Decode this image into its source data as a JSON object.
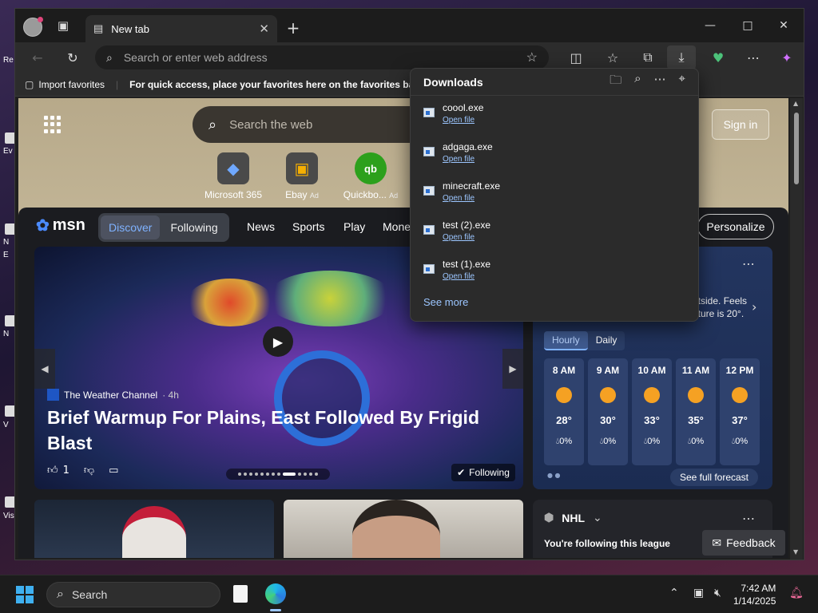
{
  "desktop": {
    "labels": [
      "Re",
      "Ev",
      "N",
      "E",
      "N",
      "V",
      "Vis"
    ]
  },
  "tab": {
    "title": "New tab"
  },
  "address": {
    "placeholder": "Search or enter web address"
  },
  "favorites": {
    "import": "Import favorites",
    "hint": "For quick access, place your favorites here on the favorites bar."
  },
  "newtab": {
    "search_placeholder": "Search the web",
    "signin": "Sign in",
    "quick_links": [
      {
        "label": "Microsoft 365",
        "ad": ""
      },
      {
        "label": "Ebay",
        "ad": "Ad"
      },
      {
        "label": "Quickbo...",
        "ad": "Ad"
      }
    ]
  },
  "msn": {
    "logo": "msn",
    "tabs": {
      "discover": "Discover",
      "following": "Following"
    },
    "nav": [
      "News",
      "Sports",
      "Play",
      "Mone"
    ],
    "personalize": "Personalize",
    "hero": {
      "source": "The Weather Channel",
      "age": "· 4h",
      "headline": "Brief Warmup For Plains, East Followed By Frigid Blast",
      "likes": "1",
      "following": "Following"
    },
    "weather": {
      "summary_line1": "utside. Feels",
      "summary_line2": "ature is 20°.",
      "tab_hourly": "Hourly",
      "tab_daily": "Daily",
      "hours": [
        {
          "time": "8 AM",
          "temp": "28°",
          "precip": "0%"
        },
        {
          "time": "9 AM",
          "temp": "30°",
          "precip": "0%"
        },
        {
          "time": "10 AM",
          "temp": "33°",
          "precip": "0%"
        },
        {
          "time": "11 AM",
          "temp": "35°",
          "precip": "0%"
        },
        {
          "time": "12 PM",
          "temp": "37°",
          "precip": "0%"
        }
      ],
      "forecast": "See full forecast"
    },
    "nhl": {
      "title": "NHL",
      "subtitle": "You're following this league"
    },
    "feedback": "Feedback"
  },
  "downloads": {
    "title": "Downloads",
    "items": [
      {
        "name": "coool.exe",
        "action": "Open file"
      },
      {
        "name": "adgaga.exe",
        "action": "Open file"
      },
      {
        "name": "minecraft.exe",
        "action": "Open file"
      },
      {
        "name": "test (2).exe",
        "action": "Open file"
      },
      {
        "name": "test (1).exe",
        "action": "Open file"
      }
    ],
    "see_more": "See more"
  },
  "taskbar": {
    "search": "Search",
    "time": "7:42 AM",
    "date": "1/14/2025"
  },
  "colors": {
    "accent": "#7fb2ff",
    "link": "#9cc6ff",
    "sun": "#f5a123"
  }
}
